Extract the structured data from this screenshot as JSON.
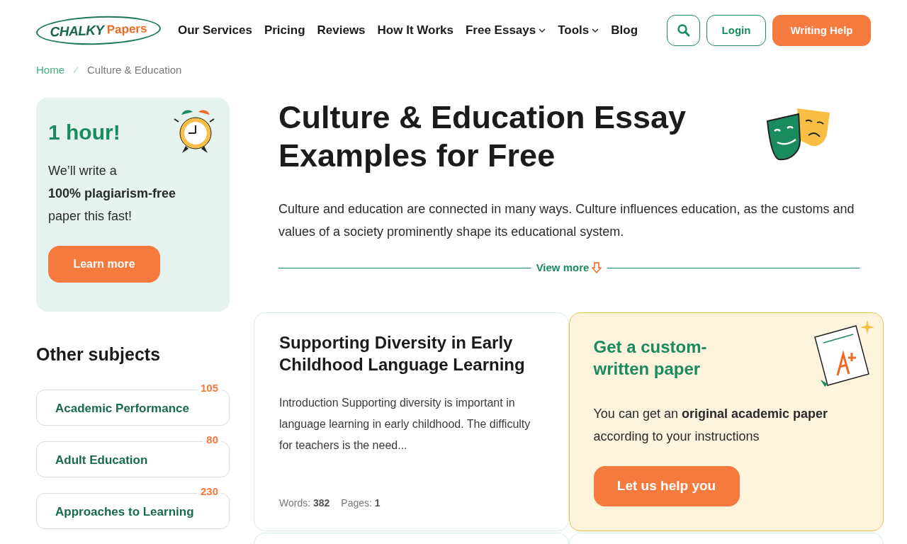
{
  "logo": {
    "word_1": "CHALKY",
    "word_2": "Papers"
  },
  "nav": [
    {
      "label": "Our Services",
      "dropdown": false
    },
    {
      "label": "Pricing",
      "dropdown": false
    },
    {
      "label": "Reviews",
      "dropdown": false
    },
    {
      "label": "How It Works",
      "dropdown": false
    },
    {
      "label": "Free Essays",
      "dropdown": true
    },
    {
      "label": "Tools",
      "dropdown": true
    },
    {
      "label": "Blog",
      "dropdown": false
    }
  ],
  "header_buttons": {
    "login": "Login",
    "cta": "Writing Help"
  },
  "breadcrumbs": [
    {
      "label": "Home",
      "link": true
    },
    {
      "label": "Culture & Education",
      "link": false
    }
  ],
  "promo": {
    "title": "1 hour!",
    "text": "We’ll write a **100% plagiarism-free** paper this fast!",
    "button": "Learn more"
  },
  "other_subjects": {
    "title": "Other subjects",
    "items": [
      {
        "name": "Academic Performance",
        "count": "105"
      },
      {
        "name": "Adult Education",
        "count": "80"
      },
      {
        "name": "Approaches to Learning",
        "count": "230"
      }
    ]
  },
  "page_title": "Culture & Education Essay Examples for Free",
  "intro": "Culture and education are connected in many ways. Culture influences education, as the customs and values of a society prominently shape its educational system.",
  "view_more": "View more",
  "essays": [
    {
      "title": "Supporting Diversity in Early Childhood Language Learning",
      "excerpt": "Introduction Supporting diversity is important in language learning in early childhood. The difficulty for teachers is the need...",
      "words_label": "Words:",
      "words": "382",
      "pages_label": "Pages:",
      "pages": "1"
    }
  ],
  "custom_card": {
    "title": "Get a custom-written paper",
    "text": "You can get an **original academic paper** according to your instructions",
    "button": "Let us help you"
  }
}
